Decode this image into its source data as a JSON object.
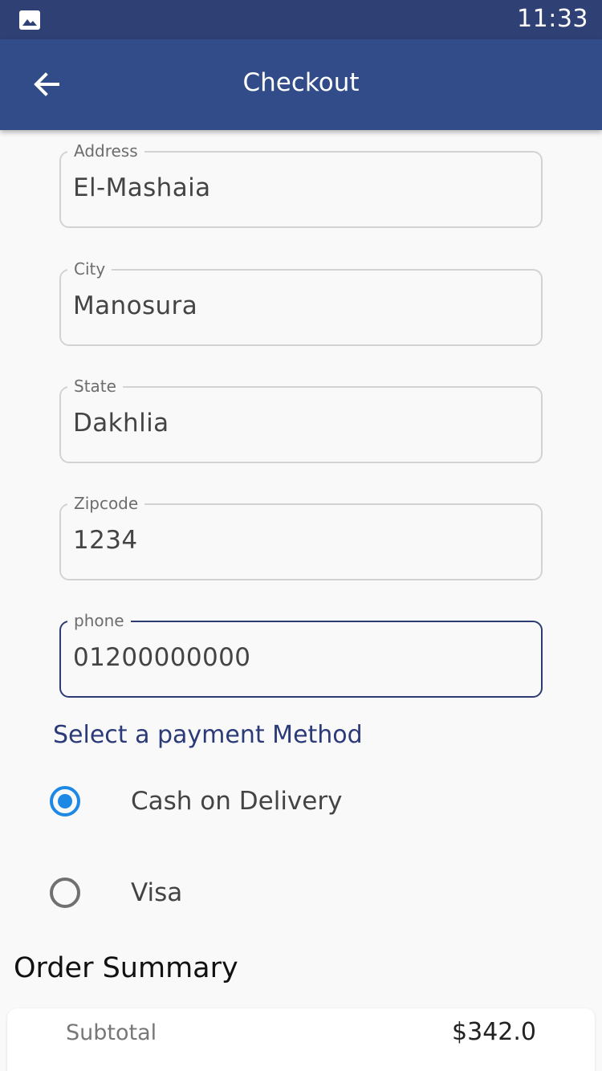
{
  "status_bar": {
    "time": "11:33",
    "icon": "image-icon"
  },
  "app_bar": {
    "title": "Checkout",
    "back_icon": "arrow-back-icon"
  },
  "form": {
    "address": {
      "label": "Address",
      "value": "El-Mashaia"
    },
    "city": {
      "label": "City",
      "value": "Manosura"
    },
    "state": {
      "label": "State",
      "value": "Dakhlia"
    },
    "zipcode": {
      "label": "Zipcode",
      "value": "1234"
    },
    "phone": {
      "label": "phone",
      "value": "01200000000"
    }
  },
  "payment": {
    "title": "Select a payment Method",
    "options": [
      {
        "label": "Cash on Delivery",
        "selected": true
      },
      {
        "label": "Visa",
        "selected": false
      }
    ]
  },
  "order_summary": {
    "title": "Order Summary",
    "rows": [
      {
        "label": "Subtotal",
        "value": "$342.0"
      }
    ]
  },
  "colors": {
    "status_bar": "#2f4075",
    "app_bar": "#324b89",
    "accent": "#1e88e5",
    "section_title": "#2b3a78",
    "background": "#f9f9f9"
  }
}
